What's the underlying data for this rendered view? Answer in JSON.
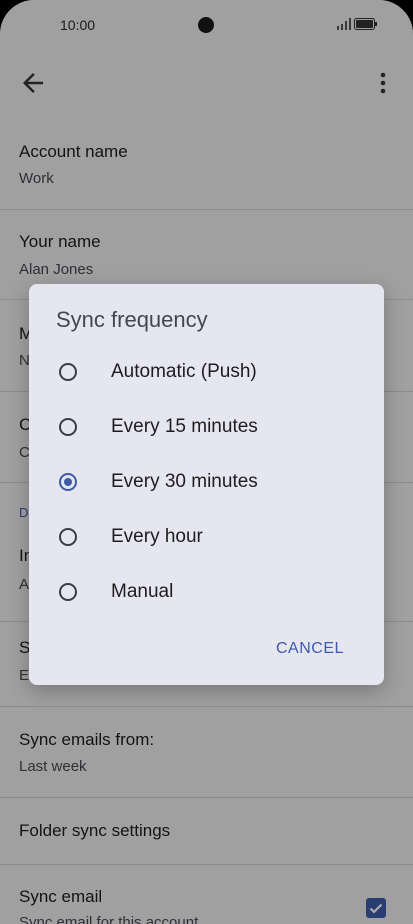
{
  "status_bar": {
    "time": "10:00"
  },
  "settings": [
    {
      "title": "Account name",
      "value": "Work"
    },
    {
      "title": "Your name",
      "value": "Alan Jones"
    },
    {
      "title": "M",
      "value": "N"
    },
    {
      "title": "C",
      "value": "C"
    },
    {
      "section": "D"
    },
    {
      "title": "In",
      "value": "A"
    },
    {
      "title": "S",
      "value": "E"
    },
    {
      "title": "Sync emails from:",
      "value": "Last week"
    },
    {
      "title": "Folder sync settings"
    },
    {
      "title": "Sync email",
      "value": "Sync email for this account",
      "checked": true
    }
  ],
  "dialog": {
    "title": "Sync frequency",
    "options": [
      {
        "label": "Automatic (Push)",
        "selected": false
      },
      {
        "label": "Every 15 minutes",
        "selected": false
      },
      {
        "label": "Every 30 minutes",
        "selected": true
      },
      {
        "label": "Every hour",
        "selected": false
      },
      {
        "label": "Manual",
        "selected": false
      }
    ],
    "cancel_label": "CANCEL"
  },
  "icons": {
    "back": "arrow-back-icon",
    "more": "more-vert-icon",
    "signal": "signal-icon",
    "battery": "battery-icon",
    "checkbox": "check-icon"
  },
  "colors": {
    "accent": "#3f5aa8"
  }
}
